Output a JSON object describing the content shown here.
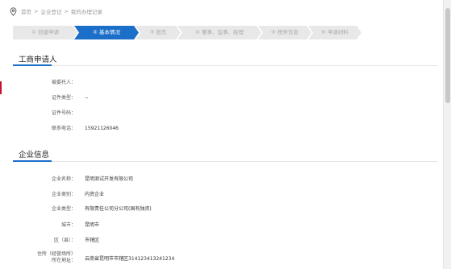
{
  "breadcrumb": {
    "items": [
      "首页",
      "企业登记",
      "我的办理记录"
    ],
    "separator": ">"
  },
  "steps": [
    {
      "label": "① 创建申请",
      "active": false
    },
    {
      "label": "② 基本情况",
      "active": true
    },
    {
      "label": "③ 股东",
      "active": false
    },
    {
      "label": "④ 董事、监事、经理",
      "active": false
    },
    {
      "label": "⑤ 税务信息",
      "active": false
    },
    {
      "label": "⑥ 申请材料",
      "active": false
    }
  ],
  "colors": {
    "accent": "#1b6fc9",
    "step_inactive": "#e8e8e8",
    "step_text": "#aaaaaa"
  },
  "section1": {
    "title": "工商申请人",
    "fields": [
      {
        "label": "被委托人：",
        "value": ""
      },
      {
        "label": "证件类型：",
        "value": "--"
      },
      {
        "label": "证件号码：",
        "value": ""
      },
      {
        "label": "联系电话：",
        "value": "15921126046"
      }
    ]
  },
  "section2": {
    "title": "企业信息",
    "fields": [
      {
        "label": "企业名称：",
        "value": "昆明测试开发有限公司"
      },
      {
        "label": "企业类别：",
        "value": "内资企业"
      },
      {
        "label": "企业类型：",
        "value": "有限责任公司分公司(国有独资)"
      },
      {
        "label": "城市：",
        "value": "昆明市"
      },
      {
        "label": "区（县）：",
        "value": "市辖区"
      },
      {
        "label_line1": "住所（经营场所）",
        "label_line2": "所在地址：",
        "value": "云南省昆明市市辖区314123413241234"
      }
    ]
  }
}
